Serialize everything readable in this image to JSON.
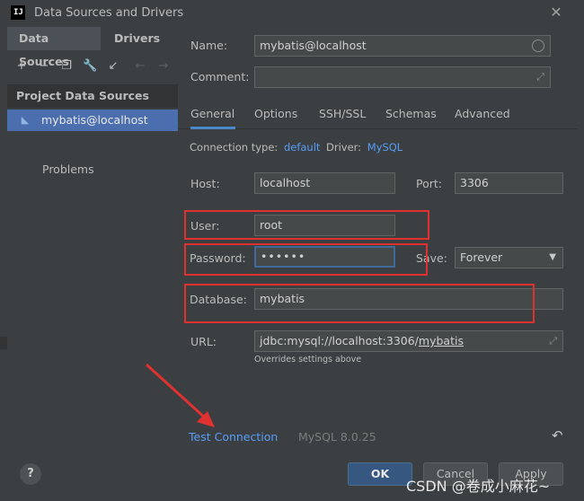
{
  "window": {
    "title": "Data Sources and Drivers",
    "app_logo_text": "IJ"
  },
  "left": {
    "tabs": [
      {
        "label": "Data Sources",
        "active": true
      },
      {
        "label": "Drivers",
        "active": false
      }
    ],
    "toolbar": [
      "add-icon",
      "remove-icon",
      "duplicate-icon",
      "wrench-icon",
      "import-icon",
      "back-icon",
      "forward-icon"
    ],
    "section": "Project Data Sources",
    "datasource": "mybatis@localhost",
    "problems": "Problems"
  },
  "form": {
    "name_label": "Name:",
    "name_value": "mybatis@localhost",
    "comment_label": "Comment:",
    "comment_value": "",
    "tabs": [
      {
        "label": "General",
        "active": true
      },
      {
        "label": "Options",
        "active": false
      },
      {
        "label": "SSH/SSL",
        "active": false
      },
      {
        "label": "Schemas",
        "active": false
      },
      {
        "label": "Advanced",
        "active": false
      }
    ],
    "connection_type_label": "Connection type:",
    "connection_type_value": "default",
    "driver_label": "Driver:",
    "driver_value": "MySQL",
    "host_label": "Host:",
    "host_value": "localhost",
    "port_label": "Port:",
    "port_value": "3306",
    "user_label": "User:",
    "user_value": "root",
    "password_label": "Password:",
    "password_value": "••••••",
    "save_label": "Save:",
    "save_value": "Forever",
    "database_label": "Database:",
    "database_value": "mybatis",
    "url_label": "URL:",
    "url_prefix": "jdbc:mysql://localhost:3306/",
    "url_db": "mybatis",
    "url_hint": "Overrides settings above"
  },
  "bottom": {
    "test_connection": "Test Connection",
    "version": "MySQL 8.0.25"
  },
  "footer": {
    "help": "?",
    "ok": "OK",
    "cancel": "Cancel",
    "apply": "Apply",
    "watermark": "CSDN @卷成小麻花~"
  },
  "colors": {
    "accent": "#589df6",
    "selection": "#4b6eaf",
    "annotation_red": "#e03131",
    "background": "#3c3f41"
  }
}
